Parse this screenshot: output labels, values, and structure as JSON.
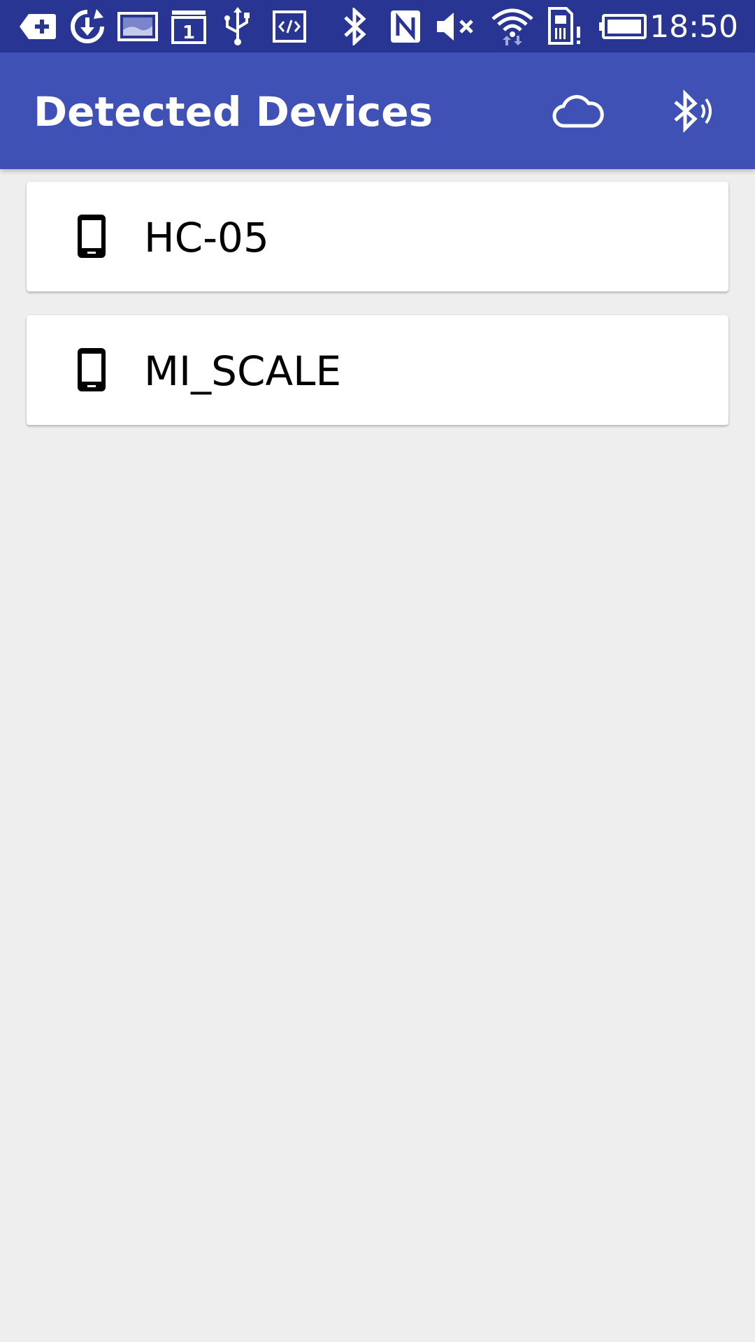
{
  "status_bar": {
    "time": "18:50",
    "icons": [
      "add-notification-icon",
      "sync-download-icon",
      "gallery-icon",
      "calendar-icon",
      "usb-icon",
      "code-icon",
      "bluetooth-icon",
      "nfc-icon",
      "volume-muted-icon",
      "wifi-icon",
      "sim-alert-icon",
      "battery-icon"
    ],
    "calendar_day": "1",
    "background": "#283593"
  },
  "app_bar": {
    "title": "Detected Devices",
    "background": "#3f51b5",
    "actions": [
      "cloud-icon",
      "bluetooth-searching-icon"
    ]
  },
  "devices": [
    {
      "name": "HC-05",
      "icon": "smartphone-icon"
    },
    {
      "name": "MI_SCALE",
      "icon": "smartphone-icon"
    }
  ]
}
